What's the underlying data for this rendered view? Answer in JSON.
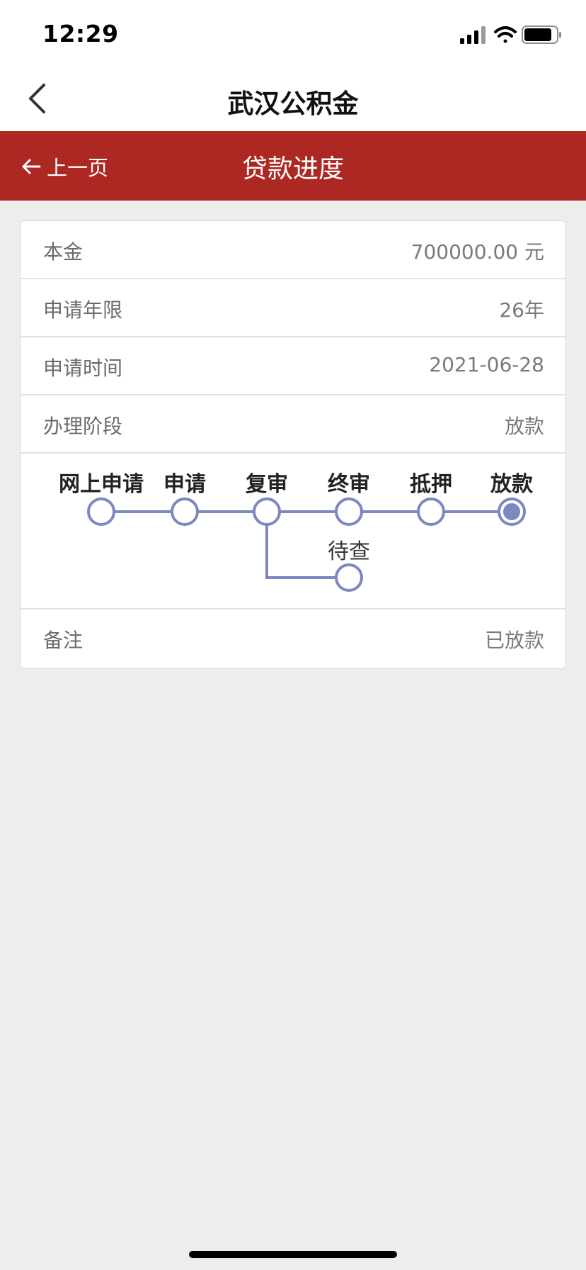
{
  "status_bar": {
    "time": "12:29"
  },
  "nav": {
    "title": "武汉公积金"
  },
  "header": {
    "back_label": "上一页",
    "title": "贷款进度"
  },
  "details": {
    "principal": {
      "label": "本金",
      "value": "700000.00 元"
    },
    "term": {
      "label": "申请年限",
      "value": "26年"
    },
    "apply_time": {
      "label": "申请时间",
      "value": "2021-06-28"
    },
    "stage": {
      "label": "办理阶段",
      "value": "放款"
    },
    "remark": {
      "label": "备注",
      "value": "已放款"
    }
  },
  "progress": {
    "steps": [
      {
        "label": "网上申请",
        "state": "done"
      },
      {
        "label": "申请",
        "state": "done"
      },
      {
        "label": "复审",
        "state": "done"
      },
      {
        "label": "终审",
        "state": "done"
      },
      {
        "label": "抵押",
        "state": "done"
      },
      {
        "label": "放款",
        "state": "current"
      }
    ],
    "branch": {
      "label": "待查",
      "from_step": "复审"
    },
    "colors": {
      "line": "#7d87c0",
      "node_fill": "#7d87c0"
    }
  }
}
